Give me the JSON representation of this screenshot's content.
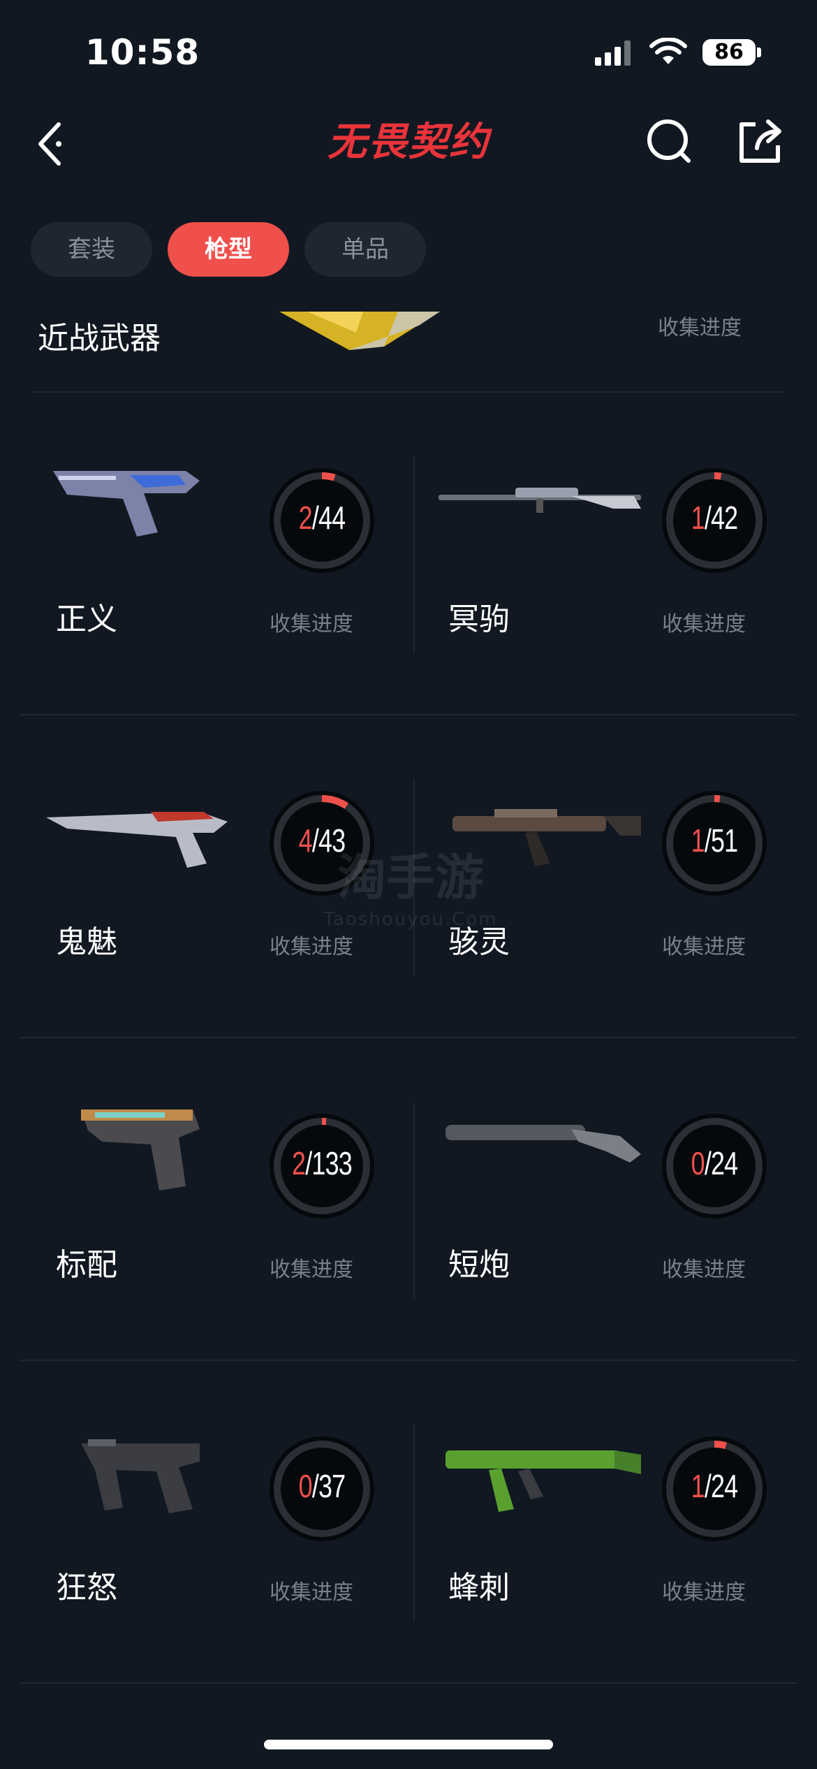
{
  "status_bar": {
    "time": "10:58",
    "battery": "86",
    "icons": [
      "signal-icon",
      "wifi-icon",
      "battery-icon"
    ]
  },
  "header": {
    "title": "无畏契约",
    "back_icon": "back-icon",
    "search_icon": "search-icon",
    "share_icon": "share-icon"
  },
  "tabs": [
    {
      "label": "套装",
      "active": false
    },
    {
      "label": "枪型",
      "active": true
    },
    {
      "label": "单品",
      "active": false
    }
  ],
  "melee": {
    "label": "近战武器",
    "progress_label": "收集进度"
  },
  "weapons": [
    {
      "name": "正义",
      "collected": "2",
      "total": "44",
      "progress_label": "收集进度"
    },
    {
      "name": "冥驹",
      "collected": "1",
      "total": "42",
      "progress_label": "收集进度"
    },
    {
      "name": "鬼魅",
      "collected": "4",
      "total": "43",
      "progress_label": "收集进度"
    },
    {
      "name": "骇灵",
      "collected": "1",
      "total": "51",
      "progress_label": "收集进度"
    },
    {
      "name": "标配",
      "collected": "2",
      "total": "133",
      "progress_label": "收集进度"
    },
    {
      "name": "短炮",
      "collected": "0",
      "total": "24",
      "progress_label": "收集进度"
    },
    {
      "name": "狂怒",
      "collected": "0",
      "total": "37",
      "progress_label": "收集进度"
    },
    {
      "name": "蜂刺",
      "collected": "1",
      "total": "24",
      "progress_label": "收集进度"
    }
  ],
  "watermark": {
    "title": "淘手游",
    "subtitle": "Taoshouyou.Com"
  },
  "colors": {
    "accent": "#f0504c",
    "background": "#111821",
    "ring_track": "#0a0d11"
  }
}
